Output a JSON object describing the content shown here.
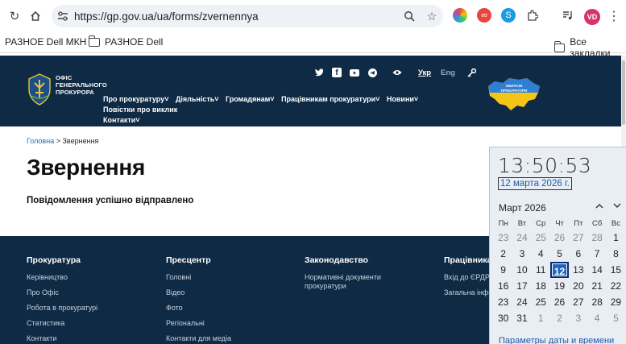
{
  "browser": {
    "url": "https://gp.gov.ua/ua/forms/zvernennya",
    "avatar_initials": "VD",
    "accent": "#d6336c"
  },
  "bookmarks": {
    "items": [
      "РАЗНОЕ Dell МКН",
      "РАЗНОЕ Dell"
    ],
    "all_bookmarks": "Все закладки"
  },
  "header": {
    "logo_line1": "Офіс",
    "logo_line2": "генерального",
    "logo_line3": "прокурора",
    "lang_active": "Укр",
    "lang_other": "Eng",
    "nav": [
      "Про прокуратуру˅",
      "Діяльність˅",
      "Громадянам˅",
      "Працівникам прокуратури˅",
      "Новини˅",
      "Повістки про виклик",
      "Контакти˅"
    ],
    "badge_line1": "ОБЛАСНІ",
    "badge_line2": "ПРОКУРАТУРИ",
    "bg_color": "#0f2a44"
  },
  "content": {
    "breadcrumb_home": "Головна",
    "breadcrumb_sep": ">",
    "breadcrumb_current": "Звернення",
    "title": "Звернення",
    "success": "Повідомлення успішно відправлено"
  },
  "footer": {
    "columns": [
      {
        "title": "Прокуратура",
        "links": [
          "Керівництво",
          "Про Офіс",
          "Робота в прокуратурі",
          "Статистика",
          "Контакти"
        ]
      },
      {
        "title": "Пресцентр",
        "links": [
          "Головні",
          "Відео",
          "Фото",
          "Регіональні",
          "Контакти для медіа"
        ]
      },
      {
        "title": "Законодавство",
        "links": [
          "Нормативні документи",
          "прокуратури"
        ]
      },
      {
        "title": "Працівникам",
        "links": [
          "Вхід до ЄРДР",
          "Загальна інфо"
        ]
      }
    ]
  },
  "clock": {
    "time": "13:50:53",
    "date": "12 марта 2026 г.",
    "month": "Март 2026",
    "weekdays": [
      "Пн",
      "Вт",
      "Ср",
      "Чт",
      "Пт",
      "Сб",
      "Вс"
    ],
    "weeks": [
      [
        "23",
        "24",
        "25",
        "26",
        "27",
        "28",
        "1"
      ],
      [
        "2",
        "3",
        "4",
        "5",
        "6",
        "7",
        "8"
      ],
      [
        "9",
        "10",
        "11",
        "12",
        "13",
        "14",
        "15"
      ],
      [
        "16",
        "17",
        "18",
        "19",
        "20",
        "21",
        "22"
      ],
      [
        "23",
        "24",
        "25",
        "26",
        "27",
        "28",
        "29"
      ],
      [
        "30",
        "31",
        "1",
        "2",
        "3",
        "4",
        "5"
      ]
    ],
    "footer_link": "Параметры даты и времени",
    "today_color": "#1f64c0"
  }
}
